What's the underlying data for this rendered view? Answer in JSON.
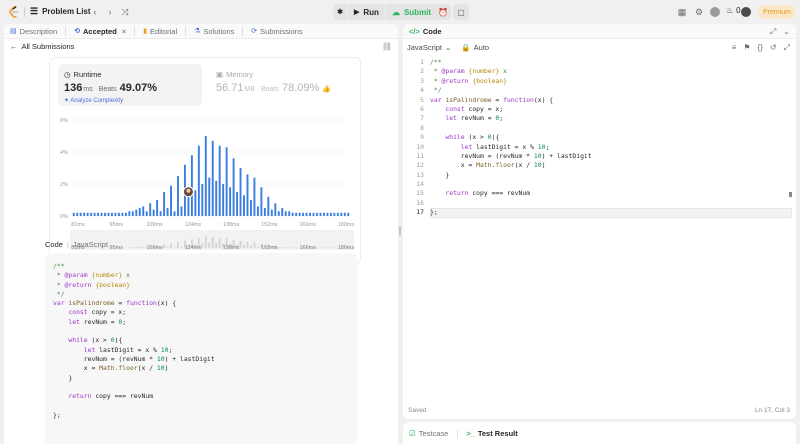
{
  "topbar": {
    "problem_list_label": "Problem List",
    "run_label": "Run",
    "submit_label": "Submit",
    "streak_count": "0",
    "premium_label": "Premium"
  },
  "left": {
    "tabs": [
      {
        "label": "Description",
        "icon": "description-icon"
      },
      {
        "label": "Accepted",
        "icon": "accepted-icon",
        "active": true
      },
      {
        "label": "Editorial",
        "icon": "editorial-icon"
      },
      {
        "label": "Solutions",
        "icon": "solutions-icon"
      },
      {
        "label": "Submissions",
        "icon": "submissions-icon"
      }
    ],
    "all_submissions_label": "All Submissions",
    "runtime": {
      "title": "Runtime",
      "value": "136",
      "unit": "ms",
      "beats_label": "Beats",
      "beats_value": "49.07%",
      "analyze_label": "Analyze Complexity"
    },
    "memory": {
      "title": "Memory",
      "value": "56.71",
      "unit": "MB",
      "beats_label": "Beats",
      "beats_value": "78.09%"
    },
    "code_label": "Code",
    "code_language": "JavaScript",
    "code_text": "/**\n * @param {number} x\n * @return {boolean}\n */\nvar isPalindrome = function(x) {\n    const copy = x;\n    let revNum = 0;\n\n    while (x > 0){\n        let lastDigit = x % 10;\n        revNum = (revNum * 10) + lastDigit\n        x = Math.floor(x / 10)\n    }\n\n    return copy === revNum\n\n};"
  },
  "chart_data": {
    "type": "bar",
    "ylim": [
      0,
      6
    ],
    "yticks": [
      "0%",
      "2%",
      "4%",
      "6%"
    ],
    "xticks": [
      "81ms",
      "95ms",
      "109ms",
      "124ms",
      "138ms",
      "152ms",
      "166ms",
      "180ms"
    ],
    "values": [
      0.2,
      0.2,
      0.2,
      0.2,
      0.2,
      0.2,
      0.2,
      0.2,
      0.2,
      0.2,
      0.2,
      0.2,
      0.2,
      0.2,
      0.2,
      0.2,
      0.3,
      0.3,
      0.4,
      0.5,
      0.6,
      0.3,
      0.8,
      0.4,
      1.0,
      0.3,
      1.5,
      0.5,
      1.9,
      0.3,
      2.5,
      0.6,
      3.2,
      1.2,
      3.8,
      1.6,
      4.4,
      2.0,
      5.0,
      2.4,
      4.7,
      2.2,
      4.4,
      2.0,
      4.3,
      1.8,
      3.6,
      1.5,
      3.0,
      1.3,
      2.6,
      1.0,
      2.4,
      0.6,
      1.8,
      0.5,
      1.2,
      0.4,
      0.8,
      0.3,
      0.5,
      0.3,
      0.3,
      0.2,
      0.2,
      0.2,
      0.2,
      0.2,
      0.2,
      0.2,
      0.2,
      0.2,
      0.2,
      0.2,
      0.2,
      0.2,
      0.2,
      0.2,
      0.2,
      0.2
    ],
    "highlight_index": 33
  },
  "right": {
    "header_title": "Code",
    "language": "JavaScript",
    "mode": "Auto",
    "status_saved": "Saved",
    "cursor_pos": "Ln 17, Col 3",
    "code_lines": [
      "/**",
      " * @param {number} x",
      " * @return {boolean}",
      " */",
      "var isPalindrome = function(x) {",
      "    const copy = x;",
      "    let revNum = 0;",
      "",
      "    while (x > 0){",
      "        let lastDigit = x % 10;",
      "        revNum = (revNum * 10) + lastDigit",
      "        x = Math.floor(x / 10)",
      "    }",
      "",
      "    return copy === revNum",
      "",
      "};"
    ],
    "current_line": 17
  },
  "bottom": {
    "testcase_label": "Testcase",
    "test_result_label": "Test Result"
  }
}
